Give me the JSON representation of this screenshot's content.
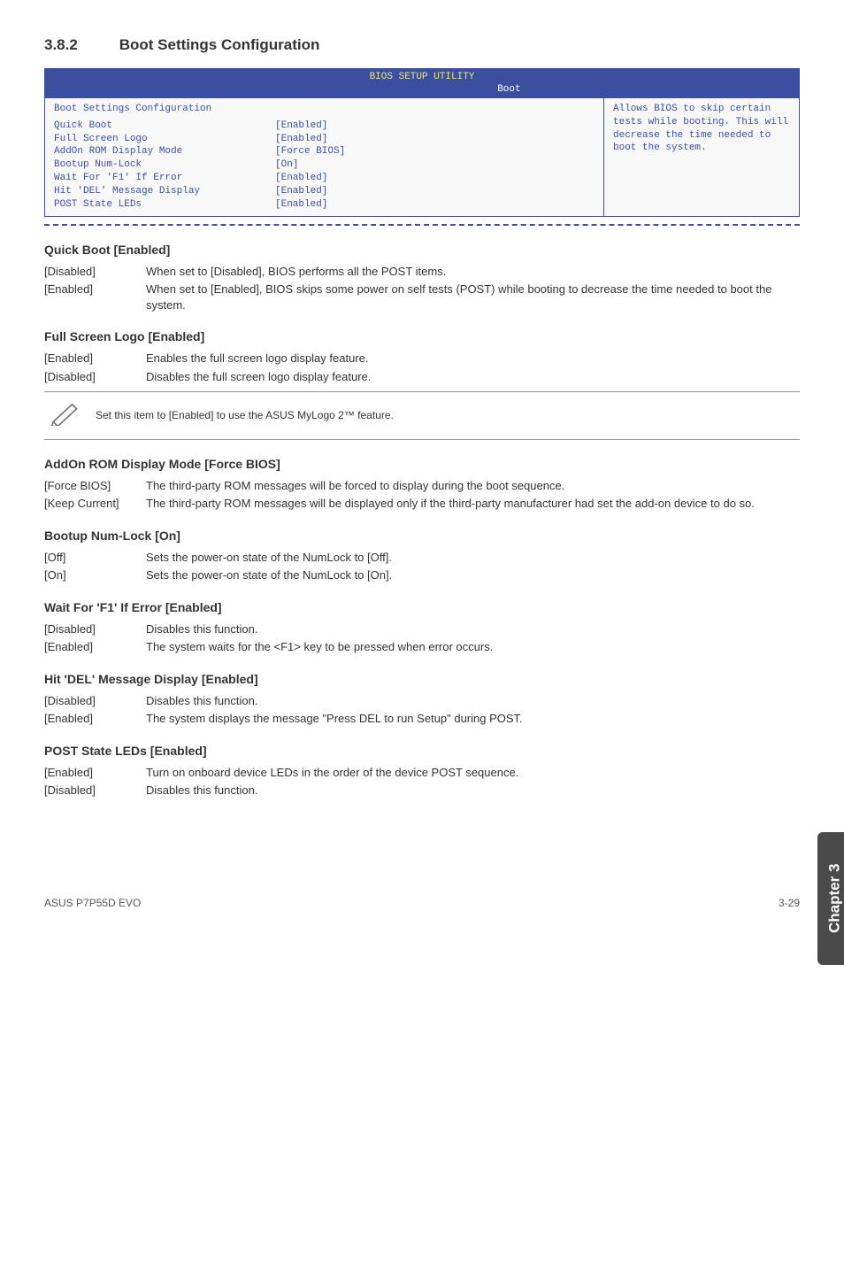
{
  "section": {
    "number": "3.8.2",
    "title": "Boot Settings Configuration"
  },
  "bios": {
    "header": "BIOS SETUP UTILITY",
    "tab": "Boot",
    "panel_title": "Boot Settings Configuration",
    "rows": [
      {
        "label": "Quick Boot",
        "value": "[Enabled]"
      },
      {
        "label": "Full Screen Logo",
        "value": "[Enabled]"
      },
      {
        "label": "AddOn ROM Display Mode",
        "value": "[Force BIOS]"
      },
      {
        "label": "Bootup Num-Lock",
        "value": "[On]"
      },
      {
        "label": "Wait For 'F1' If Error",
        "value": "[Enabled]"
      },
      {
        "label": "Hit 'DEL' Message Display",
        "value": "[Enabled]"
      },
      {
        "label": "POST State LEDs",
        "value": "[Enabled]"
      }
    ],
    "help": "Allows BIOS to skip certain tests while booting. This will decrease the time needed to boot the system."
  },
  "sub1": {
    "title": "Quick Boot [Enabled]",
    "opts": [
      {
        "k": "[Disabled]",
        "v": "When set to [Disabled], BIOS performs all the POST items."
      },
      {
        "k": "[Enabled]",
        "v": "When set to [Enabled], BIOS skips some power on self tests (POST) while booting to decrease the time needed to boot the system."
      }
    ]
  },
  "sub2": {
    "title": "Full Screen Logo [Enabled]",
    "opts": [
      {
        "k": "[Enabled]",
        "v": "Enables the full screen logo display feature."
      },
      {
        "k": "[Disabled]",
        "v": "Disables the full screen logo display feature."
      }
    ]
  },
  "note": "Set this item to [Enabled] to use the ASUS MyLogo 2™ feature.",
  "sub3": {
    "title": "AddOn ROM Display Mode [Force BIOS]",
    "opts": [
      {
        "k": "[Force BIOS]",
        "v": "The third-party ROM messages will be forced to display during the boot sequence."
      },
      {
        "k": "[Keep Current]",
        "v": "The third-party ROM messages will be displayed only if the third-party manufacturer had set the add-on device to do so."
      }
    ]
  },
  "sub4": {
    "title": "Bootup Num-Lock [On]",
    "opts": [
      {
        "k": "[Off]",
        "v": "Sets the power-on state of the NumLock to [Off]."
      },
      {
        "k": "[On]",
        "v": "Sets the power-on state of the NumLock to [On]."
      }
    ]
  },
  "sub5": {
    "title": "Wait For 'F1' If Error [Enabled]",
    "opts": [
      {
        "k": "[Disabled]",
        "v": "Disables this function."
      },
      {
        "k": "[Enabled]",
        "v": "The system waits for the <F1> key to be pressed when error occurs."
      }
    ]
  },
  "sub6": {
    "title": "Hit 'DEL' Message Display [Enabled]",
    "opts": [
      {
        "k": "[Disabled]",
        "v": "Disables this function."
      },
      {
        "k": "[Enabled]",
        "v": "The system displays the message \"Press DEL to run Setup\" during POST."
      }
    ]
  },
  "sub7": {
    "title": "POST State LEDs [Enabled]",
    "opts": [
      {
        "k": "[Enabled]",
        "v": "Turn on onboard device LEDs in the order of the device POST sequence."
      },
      {
        "k": "[Disabled]",
        "v": "Disables this function."
      }
    ]
  },
  "side_tab": "Chapter 3",
  "footer": {
    "left": "ASUS P7P55D EVO",
    "right": "3-29"
  }
}
